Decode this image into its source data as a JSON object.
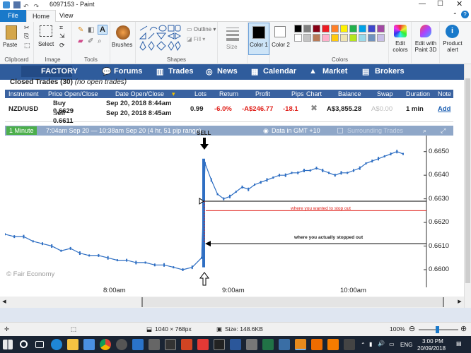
{
  "window": {
    "title": "6097153 - Paint"
  },
  "ribbon": {
    "tabs": [
      "File",
      "Home",
      "View"
    ],
    "clipboard": {
      "paste": "Paste",
      "group": "Clipboard"
    },
    "image": {
      "select": "Select",
      "group": "Image"
    },
    "tools": {
      "group": "Tools"
    },
    "brushes": "Brushes",
    "shapes": {
      "outline": "Outline",
      "fill": "Fill",
      "group": "Shapes"
    },
    "size": "Size",
    "color1": "Color 1",
    "color2": "Color 2",
    "colors_group": "Colors",
    "edit_colors": "Edit colors",
    "edit_3d": "Edit with Paint 3D",
    "product_alert": "Product alert"
  },
  "palette": [
    "#000000",
    "#7f7f7f",
    "#880015",
    "#ed1c24",
    "#ff7f27",
    "#fff200",
    "#22b14c",
    "#00a2e8",
    "#3f48cc",
    "#a349a4",
    "#ffffff",
    "#c3c3c3",
    "#b97a57",
    "#ffaec9",
    "#ffc90e",
    "#efe4b0",
    "#b5e61d",
    "#99d9ea",
    "#7092be",
    "#c8bfe7"
  ],
  "site": {
    "logo": "FACTORY",
    "nav": [
      "Forums",
      "Trades",
      "News",
      "Calendar",
      "Market",
      "Brokers"
    ]
  },
  "trades": {
    "title": "Closed Trades (30)",
    "subtitle": "(no open trades)",
    "columns": [
      "Instrument",
      "Price Open/Close",
      "Date Open/Close",
      "Lots",
      "Return",
      "Profit",
      "Pips",
      "Chart",
      "Balance",
      "Swap",
      "Duration",
      "Note"
    ],
    "row": {
      "instrument": "NZD/USD",
      "buy": "Buy 0.6629",
      "buy_sub": "4",
      "sell": "Sell 0.6611",
      "sell_sub": "3",
      "date_open": "Sep 20, 2018 8:44am",
      "date_close": "Sep 20, 2018 8:45am",
      "lots": "0.99",
      "return": "-6.0%",
      "profit": "-A$246.77",
      "pips": "-18.1",
      "balance": "A$3,855.28",
      "swap": "A$0.00",
      "duration": "1 min",
      "note": "Add"
    }
  },
  "chart_bar": {
    "timeframe": "1 Minute",
    "range": "7:04am Sep 20 — 10:38am Sep 20 (4 hr, 51 pip range)",
    "gmt": "Data in GMT +10",
    "surrounding": "Surrounding Trades"
  },
  "chart_data": {
    "type": "line",
    "x_ticks": [
      "8:00am",
      "9:00am",
      "10:00am"
    ],
    "y_ticks": [
      "0.6650",
      "0.6640",
      "0.6630",
      "0.6620",
      "0.6610",
      "0.6600"
    ],
    "ylim": [
      0.6597,
      0.6655
    ],
    "watermark": "© Fair Economy",
    "annotations": {
      "sell": "SELL",
      "stop_wanted": "where you wanted to stop out",
      "stop_actual": "where you actually stopped out"
    },
    "levels": {
      "wanted": 0.6625,
      "entry": 0.6629,
      "actual": 0.6611
    },
    "series": [
      {
        "values": [
          0.6615,
          0.6614,
          0.6614,
          0.6612,
          0.6611,
          0.661,
          0.6608,
          0.6609,
          0.6607,
          0.6606,
          0.6606,
          0.6605,
          0.6604,
          0.6604,
          0.6603,
          0.6603,
          0.6602,
          0.6602,
          0.6601,
          0.66,
          0.6601,
          0.6605,
          0.6645,
          0.6638,
          0.6632,
          0.663,
          0.6631,
          0.6633,
          0.6635,
          0.6634,
          0.6636,
          0.6637,
          0.6638,
          0.6639,
          0.664,
          0.664,
          0.6641,
          0.6641,
          0.6642,
          0.6642,
          0.6643,
          0.6642,
          0.6641,
          0.664,
          0.6641,
          0.6641,
          0.6642,
          0.6643,
          0.6645,
          0.6646,
          0.6647,
          0.6648,
          0.6649,
          0.665,
          0.6649
        ]
      }
    ]
  },
  "status": {
    "dims": "1040 × 768px",
    "size": "Size: 148.6KB",
    "zoom": "100%"
  },
  "taskbar": {
    "time": "3:00 PM",
    "date": "20/09/2018",
    "lang": "ENG"
  }
}
